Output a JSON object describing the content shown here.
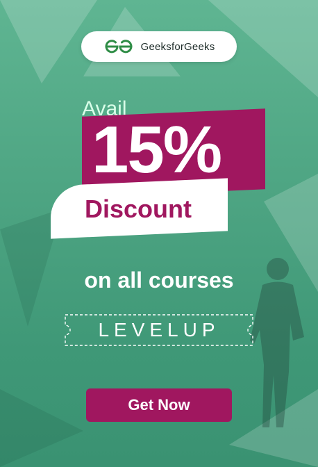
{
  "brand": {
    "name": "GeeksforGeeks",
    "logo_icon": "gfg-logo-icon",
    "logo_color": "#2f8d46"
  },
  "offer": {
    "lead": "Avail",
    "percent": "15%",
    "word": "Discount",
    "subtitle": "on all courses",
    "coupon_code": "LEVELUP"
  },
  "cta": {
    "label": "Get Now"
  },
  "colors": {
    "accent": "#a0175f",
    "background": "#4ea583",
    "text_light": "#ffffff"
  }
}
